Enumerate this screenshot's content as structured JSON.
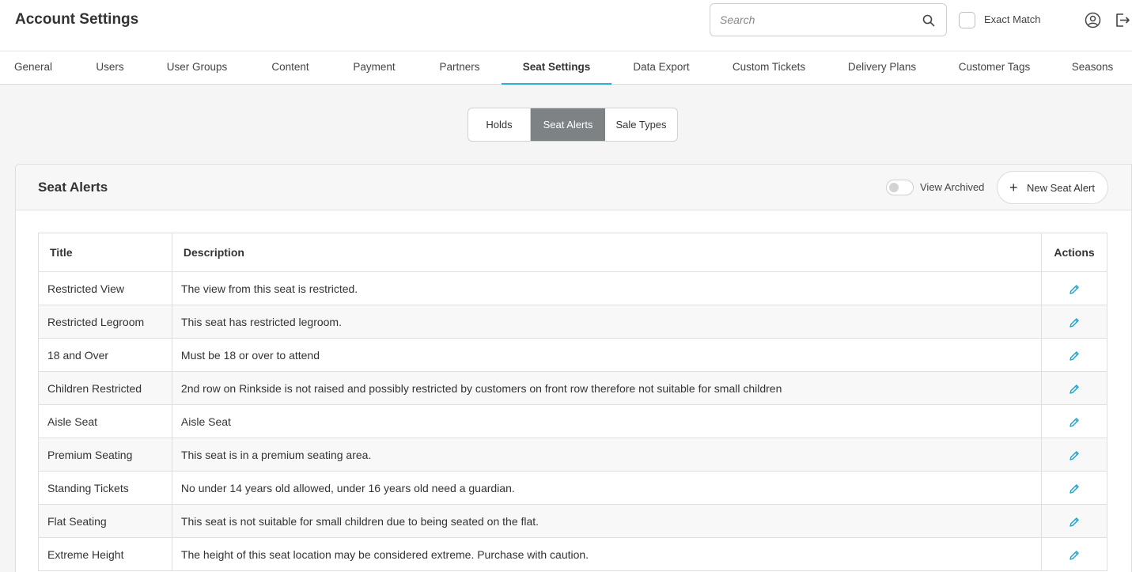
{
  "header": {
    "title": "Account Settings",
    "search_placeholder": "Search",
    "exact_match_label": "Exact Match"
  },
  "tabs": [
    {
      "label": "General"
    },
    {
      "label": "Users"
    },
    {
      "label": "User Groups"
    },
    {
      "label": "Content"
    },
    {
      "label": "Payment"
    },
    {
      "label": "Partners"
    },
    {
      "label": "Seat Settings",
      "active": true
    },
    {
      "label": "Data Export"
    },
    {
      "label": "Custom Tickets"
    },
    {
      "label": "Delivery Plans"
    },
    {
      "label": "Customer Tags"
    },
    {
      "label": "Seasons"
    }
  ],
  "subtabs": [
    {
      "label": "Holds"
    },
    {
      "label": "Seat Alerts",
      "active": true
    },
    {
      "label": "Sale Types"
    }
  ],
  "panel": {
    "title": "Seat Alerts",
    "view_archived_label": "View Archived",
    "new_button_label": "New Seat Alert"
  },
  "table": {
    "headers": {
      "title": "Title",
      "description": "Description",
      "actions": "Actions"
    },
    "rows": [
      {
        "title": "Restricted View",
        "description": "The view from this seat is restricted."
      },
      {
        "title": "Restricted Legroom",
        "description": "This seat has restricted legroom."
      },
      {
        "title": "18 and Over",
        "description": "Must be 18 or over to attend"
      },
      {
        "title": "Children Restricted",
        "description": "2nd row on Rinkside is not raised and possibly restricted by customers on front row therefore not suitable for small children"
      },
      {
        "title": "Aisle Seat",
        "description": "Aisle Seat"
      },
      {
        "title": "Premium Seating",
        "description": "This seat is in a premium seating area."
      },
      {
        "title": "Standing Tickets",
        "description": "No under 14 years old allowed, under 16 years old need a guardian."
      },
      {
        "title": "Flat Seating",
        "description": "This seat is not suitable for small children due to being seated on the flat."
      },
      {
        "title": "Extreme Height",
        "description": "The height of this seat location may be considered extreme. Purchase with caution."
      }
    ]
  },
  "colors": {
    "accent": "#2ab0d8",
    "active_subtab": "#7d8385",
    "edit_icon": "#1aa3cc"
  },
  "icons": {
    "search": "search-icon",
    "user": "user-circle-icon",
    "logout": "logout-icon",
    "plus": "plus-icon",
    "edit": "pencil-icon"
  }
}
